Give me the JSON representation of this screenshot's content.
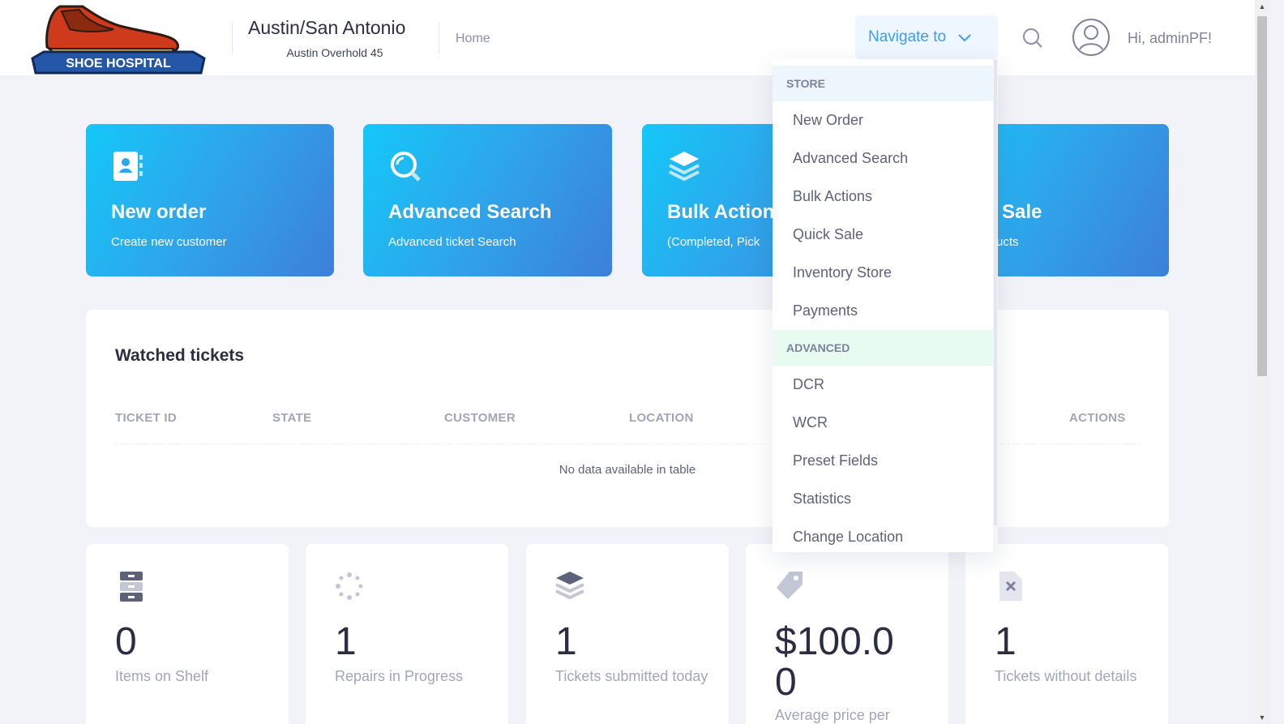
{
  "header": {
    "brand": "SHOE HOSPITAL",
    "location_title": "Austin/San Antonio",
    "location_sub": "Austin Overhold 45",
    "home_link": "Home",
    "navigate_label": "Navigate to",
    "greeting": "Hi, adminPF!"
  },
  "tiles": [
    {
      "title": "New order",
      "subtitle": "Create new customer",
      "icon": "contact-book-icon"
    },
    {
      "title": "Advanced Search",
      "subtitle": "Advanced ticket Search",
      "icon": "search-icon"
    },
    {
      "title": "Bulk Actions",
      "subtitle": "(Completed, Pick",
      "icon": "layers-icon"
    },
    {
      "title": "Sale",
      "subtitle": "ucts",
      "icon": "cart-icon"
    }
  ],
  "watched": {
    "title": "Watched tickets",
    "columns": [
      "TICKET ID",
      "STATE",
      "CUSTOMER",
      "LOCATION",
      "ACTIONS"
    ],
    "empty_text": "No data available in table"
  },
  "stats": [
    {
      "value": "0",
      "label": "Items on Shelf",
      "icon": "cabinet-icon"
    },
    {
      "value": "1",
      "label": "Repairs in Progress",
      "icon": "spinner-icon"
    },
    {
      "value": "1",
      "label": "Tickets submitted today",
      "icon": "layers-icon"
    },
    {
      "value": "$100.00",
      "label": "Average price per",
      "icon": "tag-icon"
    },
    {
      "value": "1",
      "label": "Tickets without details",
      "icon": "file-x-icon"
    }
  ],
  "dropdown": {
    "store_label": "STORE",
    "store_items": [
      "New Order",
      "Advanced Search",
      "Bulk Actions",
      "Quick Sale",
      "Inventory Store",
      "Payments"
    ],
    "advanced_label": "ADVANCED",
    "advanced_items": [
      "DCR",
      "WCR",
      "Preset Fields",
      "Statistics",
      "Change Location"
    ]
  },
  "colors": {
    "accent": "#3b9ef0",
    "tile_gradient_start": "#14c8f8",
    "tile_gradient_end": "#3d7fd9",
    "background": "#f2f3f8"
  }
}
